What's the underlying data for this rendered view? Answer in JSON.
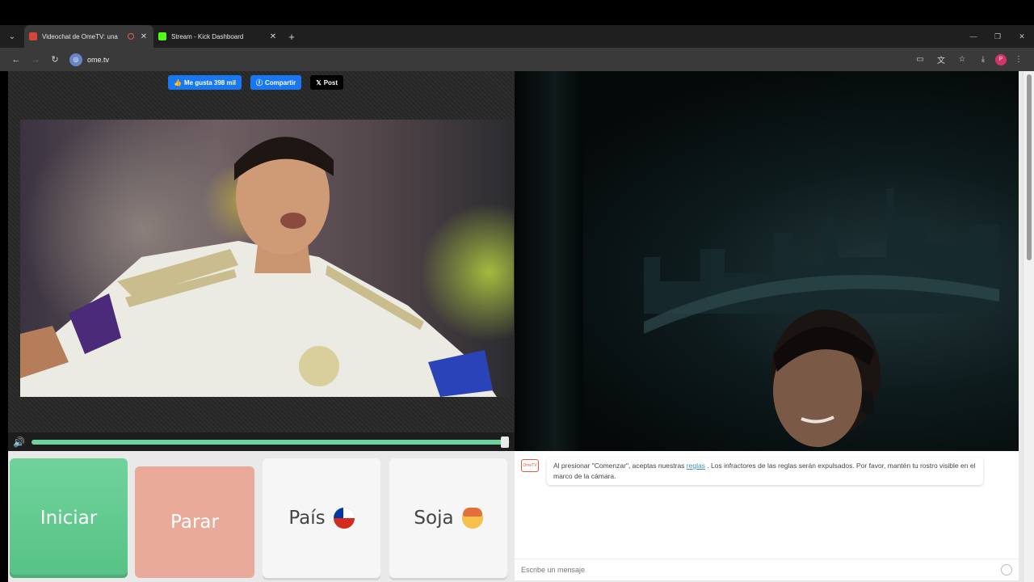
{
  "browser": {
    "tabs": [
      {
        "title": "Videochat de OmeTV: una",
        "favicon_color": "#d44638",
        "active": true
      },
      {
        "title": "Stream - Kick Dashboard",
        "favicon_color": "#53fc18",
        "active": false
      }
    ],
    "new_tab": "+",
    "url": "ome.tv",
    "profile_initial": "P"
  },
  "social": {
    "like_label": "Me gusta 398 mil",
    "share_label": "Compartir",
    "post_label": "Post"
  },
  "player": {
    "volume_progress": 0.99
  },
  "buttons": {
    "start": "Iniciar",
    "stop": "Parar",
    "country": "País",
    "gender": "Soja"
  },
  "chat": {
    "logo_text": "OmeTV",
    "notice_before": "Al presionar \"Comenzar\", aceptas nuestras ",
    "notice_link": "reglas",
    "notice_after": " . Los infractores de las reglas serán expulsados. Por favor, mantén tu rostro visible en el marco de la cámara.",
    "input_placeholder": "Escribe un mensaje"
  },
  "colors": {
    "start": "#6fd39b",
    "stop": "#eaaa99",
    "facebook": "#1877f2"
  }
}
